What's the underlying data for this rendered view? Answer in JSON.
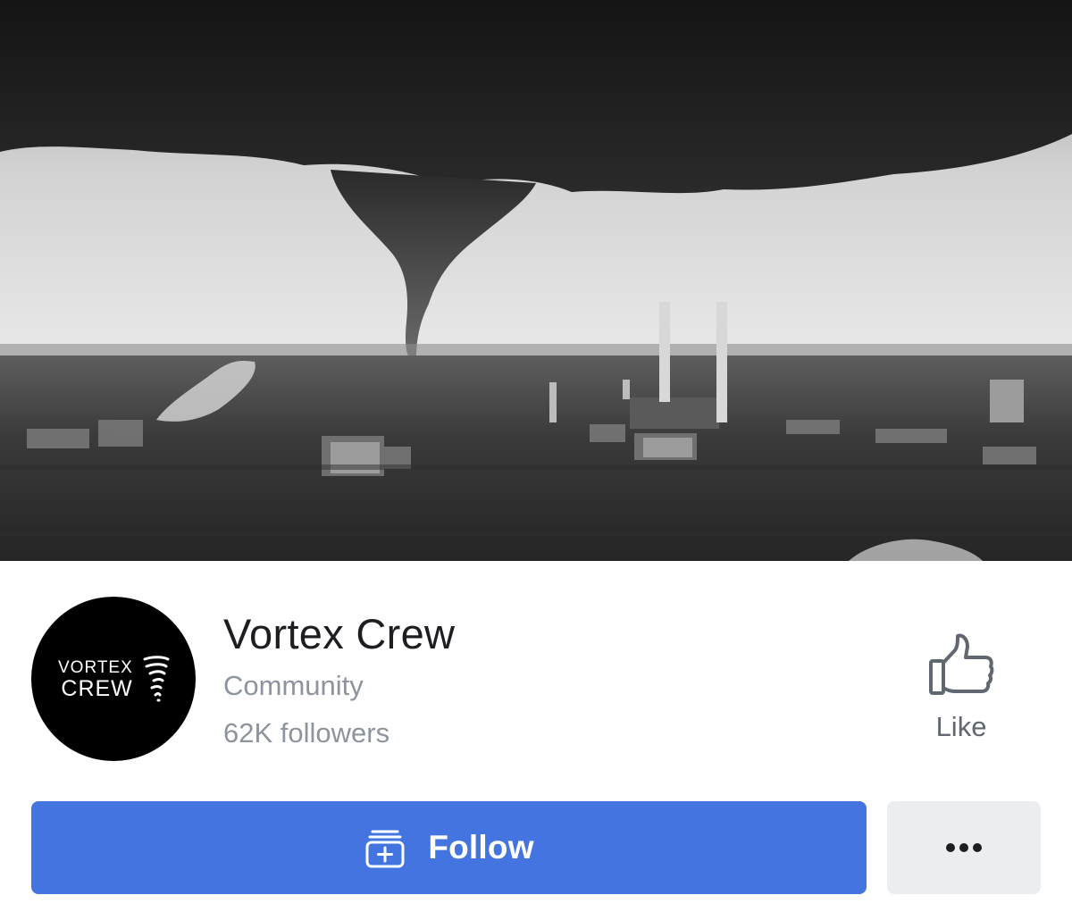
{
  "cover": {
    "description_icon": "tornado-cover-photo"
  },
  "page": {
    "name": "Vortex Crew",
    "category": "Community",
    "followers": "62K followers",
    "avatar": {
      "wordmark_line1": "VORTEX",
      "wordmark_line2": "CREW",
      "icon": "tornado-icon"
    }
  },
  "actions": {
    "like_label": "Like",
    "like_icon": "thumbs-up-icon",
    "follow_label": "Follow",
    "follow_icon": "follow-icon",
    "more_icon": "more-dots-icon"
  },
  "colors": {
    "primary": "#4374e0",
    "secondary_button": "#ebedf0",
    "text_primary": "#1c1e21",
    "text_secondary": "#8d949e",
    "like_text": "#606770"
  }
}
